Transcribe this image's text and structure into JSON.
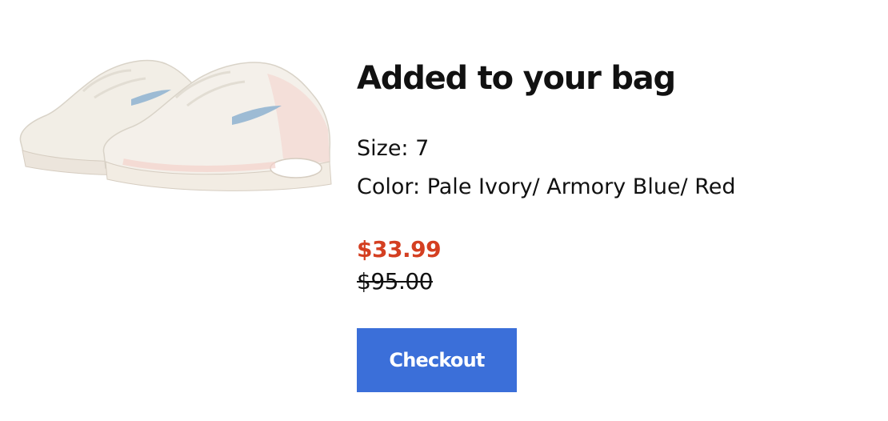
{
  "product": {
    "image_alt": "Pale Ivory sneakers with blue swoosh",
    "image_icon": "sneaker-pair-image"
  },
  "confirmation": {
    "title": "Added to your bag"
  },
  "attributes": {
    "size": "Size: 7",
    "color": "Color: Pale Ivory/ Armory Blue/ Red"
  },
  "pricing": {
    "sale_price": "$33.99",
    "original_price": "$95.00"
  },
  "actions": {
    "checkout_label": "Checkout"
  },
  "colors": {
    "sale": "#d43f21",
    "button": "#3b6fd9",
    "text": "#111111"
  }
}
